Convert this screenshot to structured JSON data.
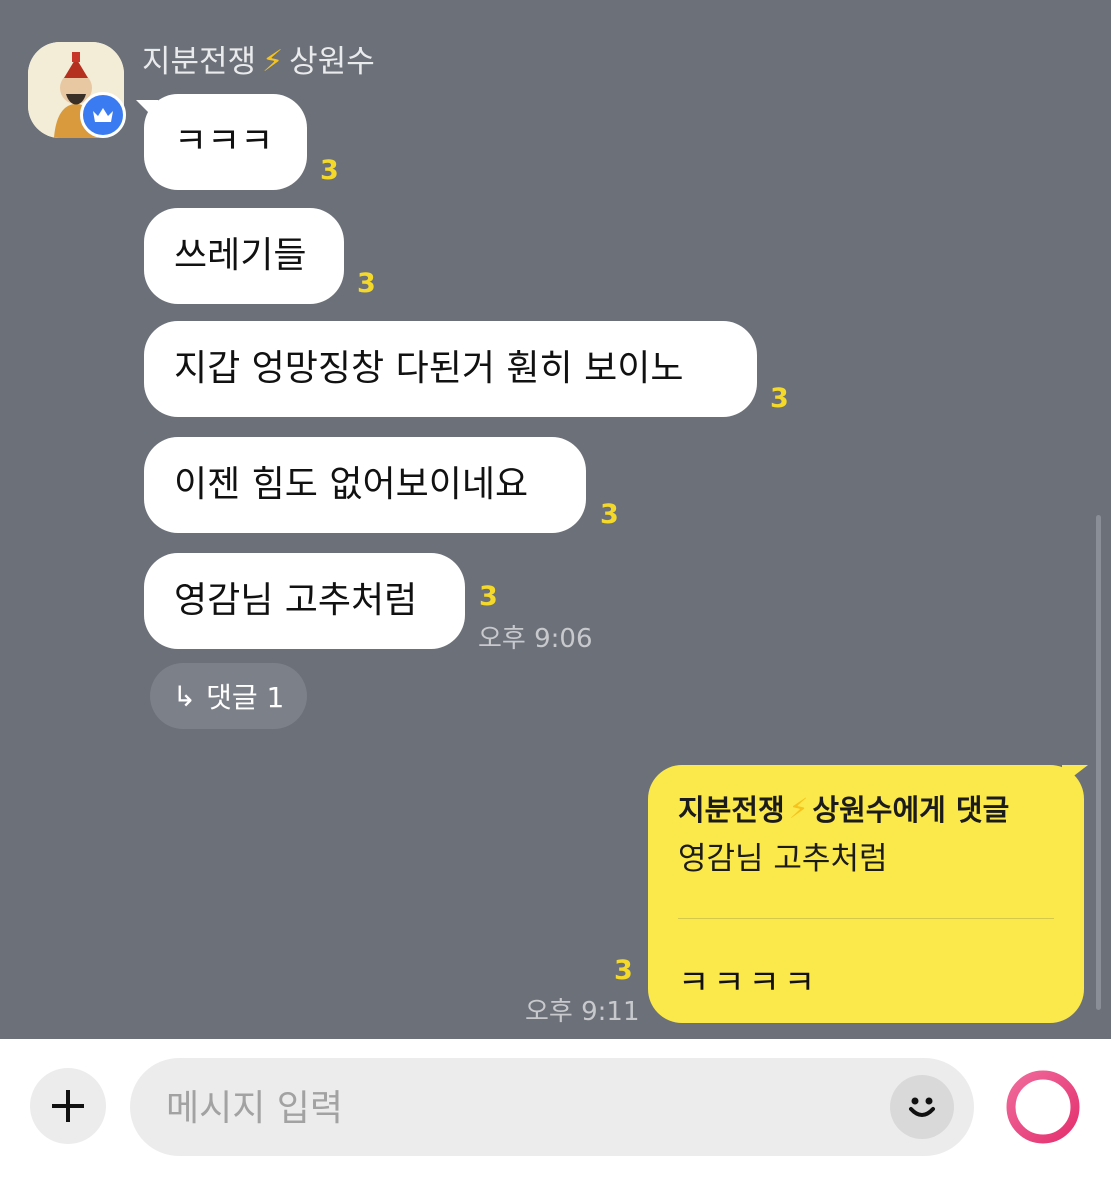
{
  "chat": {
    "sender": {
      "name": "지분전쟁",
      "bolt": "⚡",
      "name_suffix": "상원수"
    },
    "messages": [
      {
        "text": "ㅋㅋㅋ",
        "count": "3"
      },
      {
        "text": "쓰레기들",
        "count": "3"
      },
      {
        "text": "지갑 엉망징창 다된거 훤히 보이노",
        "count": "3"
      },
      {
        "text": "이젠 힘도 없어보이네요",
        "count": "3"
      },
      {
        "text": "영감님 고추처럼",
        "count": "3",
        "time": "오후 9:06"
      }
    ],
    "reply_chip": {
      "arrow": "↳",
      "label": "댓글 1"
    },
    "my_message": {
      "reply_to_name": "지분전쟁",
      "reply_to_bolt": "⚡",
      "reply_to_suffix": "상원수에게 댓글",
      "quoted_text": "영감님 고추처럼",
      "text": "ㅋㅋㅋㅋ",
      "count": "3",
      "time": "오후 9:11"
    }
  },
  "input": {
    "placeholder": "메시지 입력",
    "value": ""
  },
  "icons": {
    "avatar": "avatar",
    "badge": "crown-icon",
    "plus": "plus-icon",
    "emoji": "emoji-icon",
    "send": "send-icon"
  },
  "colors": {
    "background": "#6b7079",
    "bubble": "#ffffff",
    "my_bubble": "#fbe84b",
    "unread_count": "#f5d92a",
    "badge": "#3b7bf2",
    "send_ring": "#ec4f86"
  }
}
